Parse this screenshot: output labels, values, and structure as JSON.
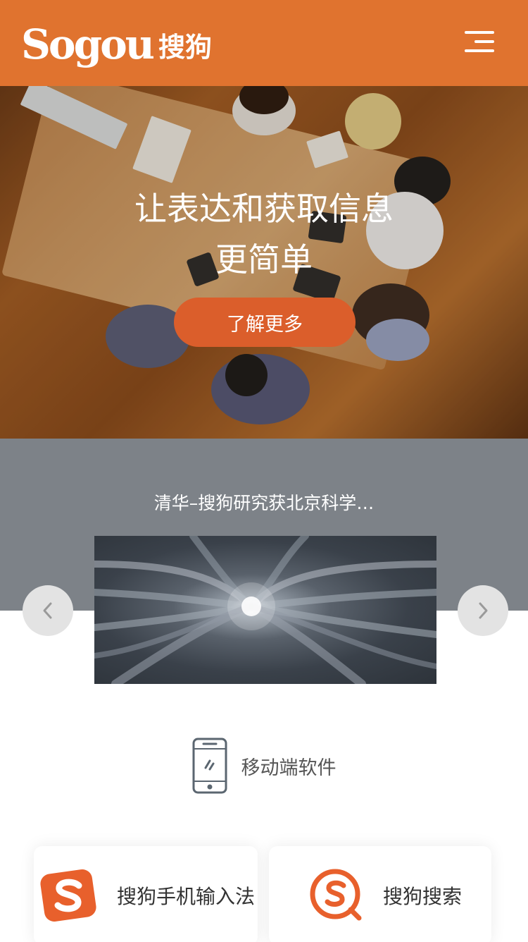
{
  "header": {
    "logo_word": "Sogou",
    "logo_cn": "搜狗",
    "brand_color": "#E0732F",
    "menu_icon": "hamburger-menu-icon"
  },
  "hero": {
    "title": "让表达和获取信息更简单",
    "cta_label": "了解更多",
    "cta_color": "#DB5E2B"
  },
  "news": {
    "title": "清华–搜狗研究获北京科学…",
    "band_color": "#7D8288",
    "prev_icon": "chevron-left-icon",
    "next_icon": "chevron-right-icon"
  },
  "section": {
    "icon": "smartphone-icon",
    "title": "移动端软件"
  },
  "products": [
    {
      "label": "搜狗手机输入法",
      "icon": "sogou-input-icon",
      "color": "#E8602C"
    },
    {
      "label": "搜狗搜索",
      "icon": "sogou-search-icon",
      "color": "#E8602C"
    }
  ]
}
